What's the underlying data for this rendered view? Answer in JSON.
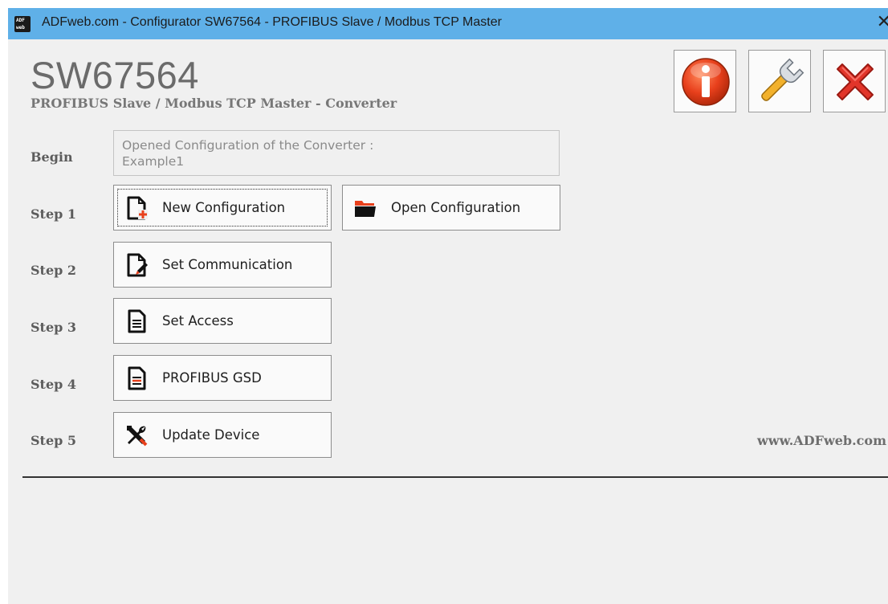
{
  "window": {
    "title": "ADFweb.com - Configurator SW67564 - PROFIBUS Slave / Modbus TCP Master",
    "logo_text_top": "ADF",
    "logo_text_bottom": "web",
    "close_glyph": "✕"
  },
  "header": {
    "product_code": "SW67564",
    "subtitle": "PROFIBUS Slave / Modbus TCP Master - Converter",
    "toolbar": [
      {
        "name": "info",
        "icon": "info-icon",
        "color": "#e8401c"
      },
      {
        "name": "settings",
        "icon": "wrench-icon",
        "color": "#f2b12c"
      },
      {
        "name": "exit",
        "icon": "close-red-x-icon",
        "color": "#e2352a"
      }
    ]
  },
  "steps": {
    "begin_label": "Begin",
    "step1_label": "Step 1",
    "step2_label": "Step 2",
    "step3_label": "Step 3",
    "step4_label": "Step 4",
    "step5_label": "Step 5"
  },
  "config_info": {
    "line1": "Opened Configuration of the Converter :",
    "line2": "Example1"
  },
  "buttons": {
    "new_config": "New Configuration",
    "open_config": "Open Configuration",
    "set_communication": "Set Communication",
    "set_access": "Set Access",
    "profibus_gsd": "PROFIBUS GSD",
    "update_device": "Update Device"
  },
  "footer": {
    "website": "www.ADFweb.com"
  }
}
